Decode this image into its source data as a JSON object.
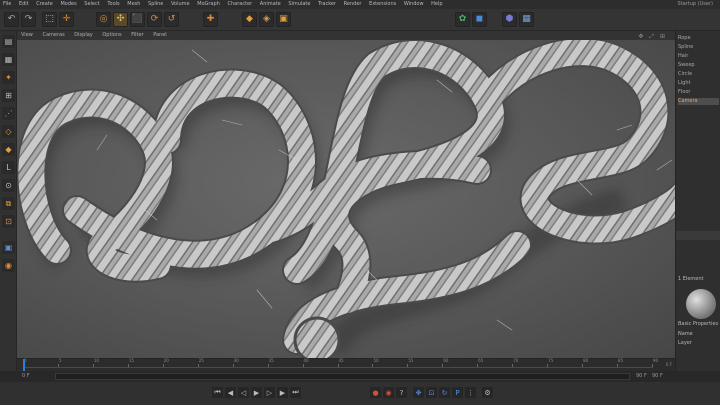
{
  "menubar": {
    "items": [
      "File",
      "Edit",
      "Create",
      "Modes",
      "Select",
      "Tools",
      "Mesh",
      "Spline",
      "Volume",
      "MoGraph",
      "Character",
      "Animate",
      "Simulate",
      "Tracker",
      "Render",
      "Extensions",
      "Window",
      "Help"
    ],
    "layout_label": "Startup (User)"
  },
  "toolbar": {
    "icons": [
      "undo-icon",
      "redo-icon",
      "live-select-icon",
      "move-icon",
      "scale-icon",
      "rotate-icon",
      "render-view-icon",
      "render-region-icon",
      "render-settings-icon",
      "cube-icon",
      "pen-icon",
      "subdivision-icon",
      "cloner-icon",
      "deformer-icon",
      "floor-icon",
      "camera-icon",
      "light-icon"
    ]
  },
  "viewport_menu": {
    "items": [
      "View",
      "Cameras",
      "Display",
      "Options",
      "Filter",
      "Panel"
    ]
  },
  "object_manager": {
    "items": [
      "Rope",
      "Spline",
      "Hair",
      "Sweep",
      "Circle",
      "Light",
      "Floor",
      "Camera"
    ],
    "selected_index": 7
  },
  "attributes": {
    "material_label": "1 Element",
    "section_label": "Basic Properties",
    "rows": [
      "Name",
      "Layer"
    ]
  },
  "timeline": {
    "ticks": [
      "0",
      "5",
      "10",
      "15",
      "20",
      "25",
      "30",
      "35",
      "40",
      "45",
      "50",
      "55",
      "60",
      "65",
      "70",
      "75",
      "80",
      "85",
      "90"
    ],
    "end_label": "0 F",
    "current_frame_fraction": 0.0
  },
  "framebar": {
    "start": "0 F",
    "end": "90 F",
    "end2": "90 F"
  },
  "colors": {
    "accent": "#e0a070",
    "playhead": "#2f7fd6",
    "record": "#d0503a"
  }
}
